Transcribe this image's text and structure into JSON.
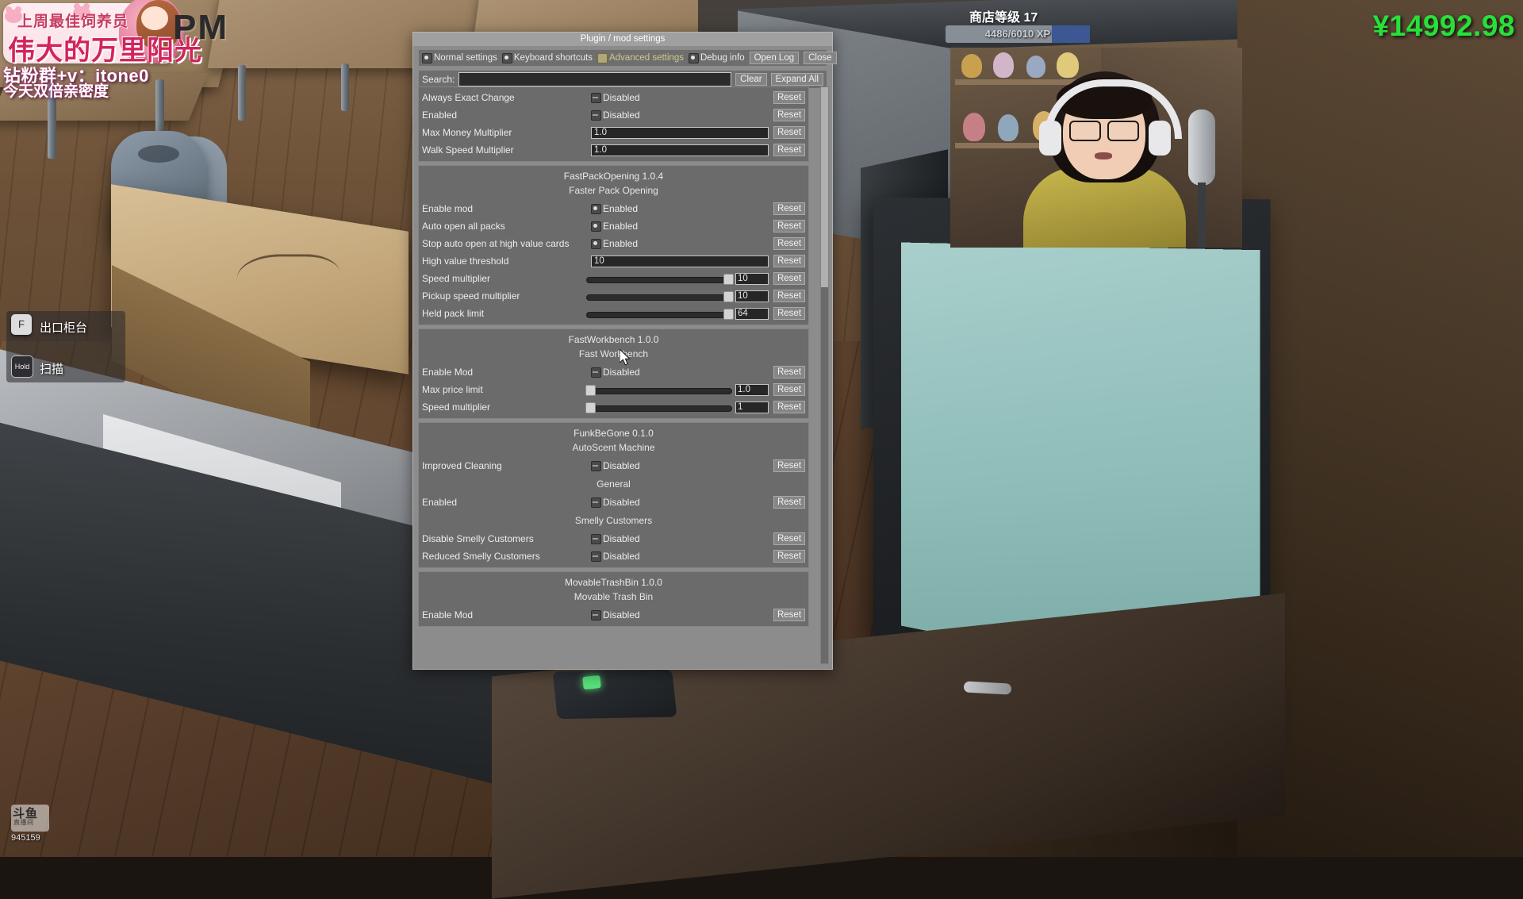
{
  "stream_overlay": {
    "banner_top_text": "上周最佳饲养员",
    "banner_name": "伟大的万里阳光",
    "sub_line1": "钻粉群+v：itone0",
    "sub_line2": "今天双倍亲密度",
    "pm_text": "PM",
    "watermark_line1": "斗鱼",
    "watermark_line2": "直播间",
    "watermark_id": "945159"
  },
  "game_hud": {
    "store_level_label": "商店等级",
    "store_level_value": "17",
    "xp_text": "4486/6010 XP",
    "money": "¥14992.98",
    "prompt_1_key": "F",
    "prompt_1_label": "出口柜台",
    "prompt_2_key": "Hold",
    "prompt_2_label": "扫描"
  },
  "window": {
    "title": "Plugin / mod settings",
    "toolbar": {
      "tabs": [
        {
          "label": "Normal settings",
          "state": "on",
          "active": false
        },
        {
          "label": "Keyboard shortcuts",
          "state": "on",
          "active": false
        },
        {
          "label": "Advanced settings",
          "state": "adv",
          "active": true
        },
        {
          "label": "Debug info",
          "state": "on",
          "active": false
        }
      ],
      "open_log_label": "Open Log",
      "close_label": "Close"
    },
    "search": {
      "label": "Search:",
      "value": "",
      "placeholder": "",
      "clear_label": "Clear",
      "expand_all_label": "Expand All"
    },
    "reset_label": "Reset",
    "groups": [
      {
        "id": "top-group",
        "title": null,
        "subtitle": null,
        "rows": [
          {
            "label": "Always Exact Change",
            "type": "checkbox",
            "state": "off",
            "state_label": "Disabled"
          },
          {
            "label": "Enabled",
            "type": "checkbox",
            "state": "off",
            "state_label": "Disabled"
          },
          {
            "label": "Max Money Multiplier",
            "type": "text",
            "value": "1.0"
          },
          {
            "label": "Walk Speed Multiplier",
            "type": "text",
            "value": "1.0"
          }
        ]
      },
      {
        "id": "fastpackopening",
        "title": "FastPackOpening 1.0.4",
        "subtitle": "Faster Pack Opening",
        "rows": [
          {
            "label": "Enable mod",
            "type": "checkbox",
            "state": "on",
            "state_label": "Enabled"
          },
          {
            "label": "Auto open all packs",
            "type": "checkbox",
            "state": "on",
            "state_label": "Enabled"
          },
          {
            "label": "Stop auto open at high value cards",
            "type": "checkbox",
            "state": "on",
            "state_label": "Enabled"
          },
          {
            "label": "High value threshold",
            "type": "text",
            "value": "10"
          },
          {
            "label": "Speed multiplier",
            "type": "slider",
            "value": "10",
            "fill_pct": 97
          },
          {
            "label": "Pickup speed multiplier",
            "type": "slider",
            "value": "10",
            "fill_pct": 97
          },
          {
            "label": "Held pack limit",
            "type": "slider",
            "value": "64",
            "fill_pct": 97
          }
        ]
      },
      {
        "id": "fastworkbench",
        "title": "FastWorkbench 1.0.0",
        "subtitle": "Fast Workbench",
        "rows": [
          {
            "label": "Enable Mod",
            "type": "checkbox",
            "state": "off",
            "state_label": "Disabled"
          },
          {
            "label": "Max price limit",
            "type": "slider",
            "value": "1.0",
            "fill_pct": 2
          },
          {
            "label": "Speed multiplier",
            "type": "slider",
            "value": "1",
            "fill_pct": 2
          }
        ]
      },
      {
        "id": "funkbegone",
        "title": "FunkBeGone 0.1.0",
        "subtitle": "AutoScent Machine",
        "rows": [
          {
            "label": "Improved Cleaning",
            "type": "checkbox",
            "state": "off",
            "state_label": "Disabled"
          },
          {
            "label": "General",
            "type": "section"
          },
          {
            "label": "Enabled",
            "type": "checkbox",
            "state": "off",
            "state_label": "Disabled"
          },
          {
            "label": "Smelly Customers",
            "type": "section"
          },
          {
            "label": "Disable Smelly Customers",
            "type": "checkbox",
            "state": "off",
            "state_label": "Disabled"
          },
          {
            "label": "Reduced Smelly Customers",
            "type": "checkbox",
            "state": "off",
            "state_label": "Disabled"
          }
        ]
      },
      {
        "id": "movabletrashbin",
        "title": "MovableTrashBin 1.0.0",
        "subtitle": "Movable Trash Bin",
        "rows": [
          {
            "label": "Enable Mod",
            "type": "checkbox",
            "state": "off",
            "state_label": "Disabled"
          }
        ]
      }
    ]
  }
}
